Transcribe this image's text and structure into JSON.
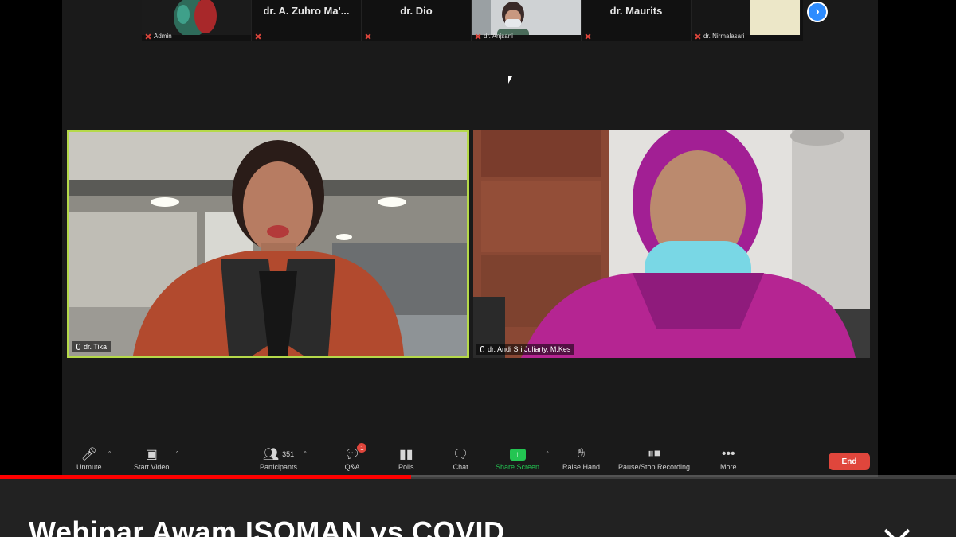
{
  "thumbnails": [
    {
      "name": "",
      "label": "Admin",
      "video": true
    },
    {
      "name": "dr. A. Zuhro Ma'...",
      "label": "",
      "video": false
    },
    {
      "name": "dr. Dio",
      "label": "",
      "video": false
    },
    {
      "name": "",
      "label": "dr. Anjsani",
      "video": true
    },
    {
      "name": "dr. Maurits",
      "label": "",
      "video": false
    },
    {
      "name": "",
      "label": "dr. Nirmalasari",
      "video": true
    }
  ],
  "next_page_icon": "chevron-right-icon",
  "tiles": [
    {
      "name": "dr. Tika",
      "active_speaker": true
    },
    {
      "name": "dr. Andi Sri Juliarty, M.Kes",
      "active_speaker": false
    }
  ],
  "toolbar": {
    "unmute": "Unmute",
    "start_video": "Start Video",
    "participants": "Participants",
    "participants_count": "351",
    "qa": "Q&A",
    "qa_badge": "1",
    "polls": "Polls",
    "chat": "Chat",
    "share_screen": "Share Screen",
    "raise_hand": "Raise Hand",
    "recording": "Pause/Stop Recording",
    "more": "More",
    "end": "End"
  },
  "colors": {
    "active_speaker_border": "#b5d94a",
    "end_button": "#e0463c",
    "share_screen": "#23c552",
    "progress": "#ff0000"
  },
  "video_progress": 0.43,
  "video_title": "Webinar Awam ISOMAN vs COVID"
}
